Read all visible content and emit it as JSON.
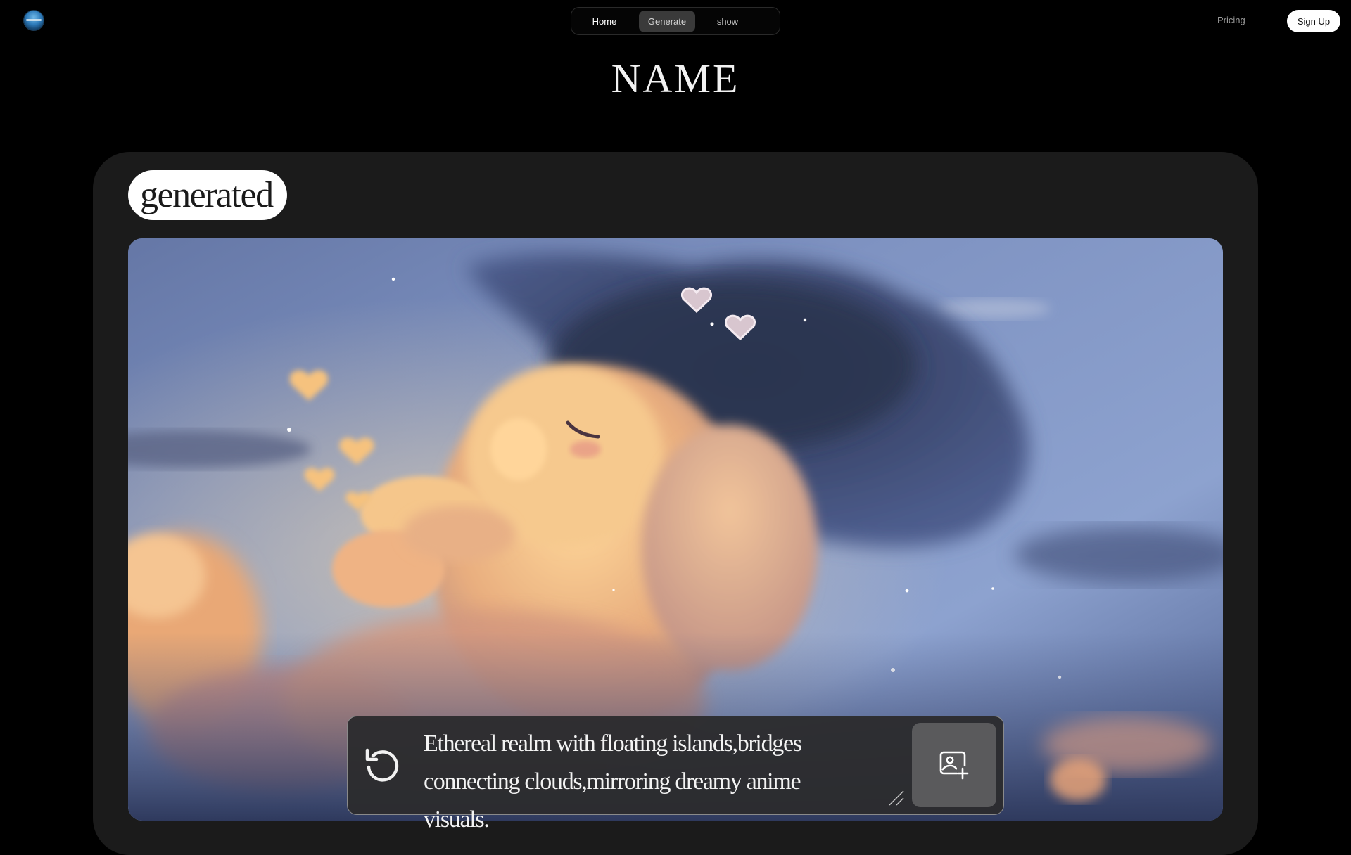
{
  "header": {
    "logo_icon": "globe-logo-icon",
    "nav": {
      "home_label": "Home",
      "generate_label": "Generate",
      "show_label": "show"
    },
    "pricing_label": "Pricing",
    "signup_label": "Sign Up"
  },
  "page": {
    "title": "NAME"
  },
  "panel": {
    "badge_label": "generated",
    "image_icon": "generated-image",
    "prompt": {
      "line1": "Ethereal realm with floating islands,bridges",
      "line2": "connecting clouds,mirroring dreamy anime visuals.",
      "regenerate_icon": "refresh-icon",
      "resize_icon": "resize-handle-icon",
      "upload_icon": "image-add-icon"
    }
  },
  "colors": {
    "background": "#000000",
    "panel": "#1b1b1b",
    "active_tab": "#3a3a3a",
    "prompt_bar": "#2c2c2e",
    "upload_button": "#5a5a5c"
  }
}
